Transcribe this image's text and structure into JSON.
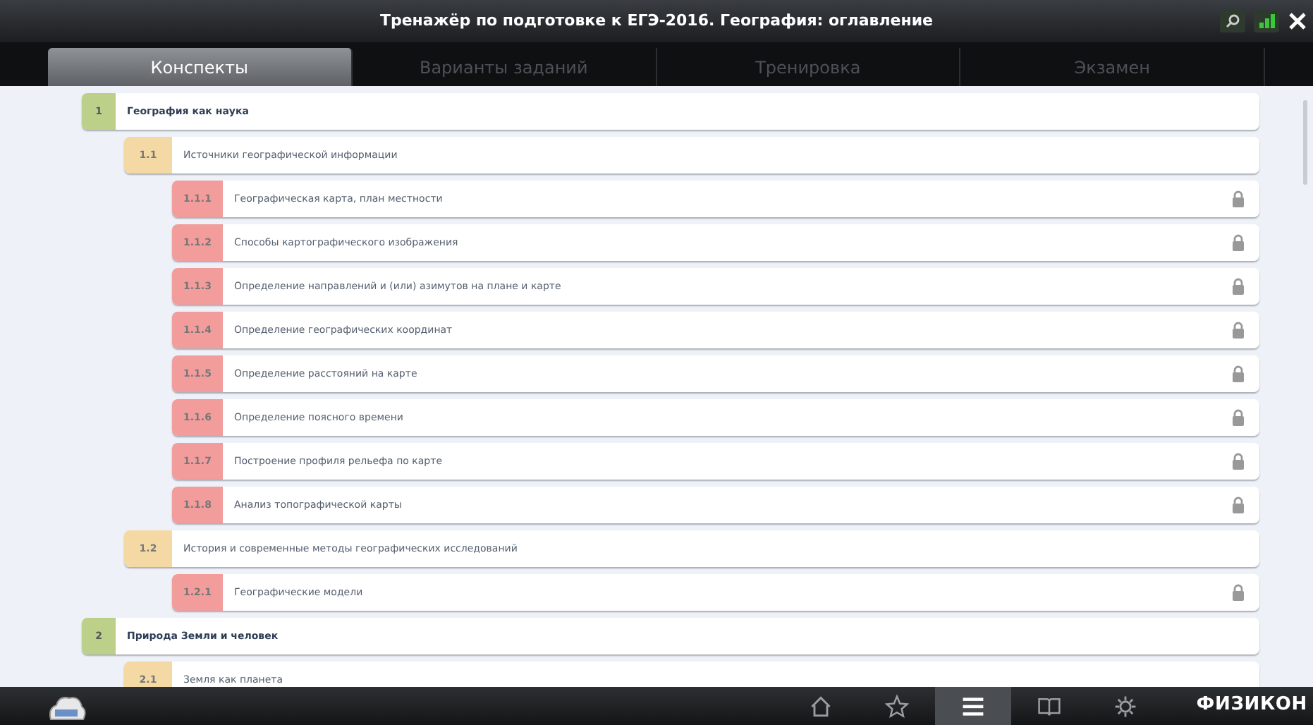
{
  "window": {
    "title": "Тренажёр по подготовке к ЕГЭ-2016. География: оглавление"
  },
  "tabs": [
    {
      "label": "Конспекты",
      "selected": true
    },
    {
      "label": "Варианты заданий",
      "selected": false
    },
    {
      "label": "Тренировка",
      "selected": false
    },
    {
      "label": "Экзамен",
      "selected": false
    }
  ],
  "contents": [
    {
      "number": "1",
      "title": "География как наука",
      "locked": false,
      "children": [
        {
          "number": "1.1",
          "title": "Источники географической информации",
          "locked": false,
          "children": [
            {
              "number": "1.1.1",
              "title": "Географическая карта, план местности",
              "locked": true
            },
            {
              "number": "1.1.2",
              "title": "Способы картографического изображения",
              "locked": true
            },
            {
              "number": "1.1.3",
              "title": "Определение направлений и (или) азимутов на плане и карте",
              "locked": true
            },
            {
              "number": "1.1.4",
              "title": "Определение географических координат",
              "locked": true
            },
            {
              "number": "1.1.5",
              "title": "Определение расстояний на карте",
              "locked": true
            },
            {
              "number": "1.1.6",
              "title": "Определение поясного времени",
              "locked": true
            },
            {
              "number": "1.1.7",
              "title": "Построение профиля рельефа по карте",
              "locked": true
            },
            {
              "number": "1.1.8",
              "title": "Анализ топографической карты",
              "locked": true
            }
          ]
        },
        {
          "number": "1.2",
          "title": "История и современные методы географических исследований",
          "locked": false,
          "children": [
            {
              "number": "1.2.1",
              "title": "Географические модели",
              "locked": true
            }
          ]
        }
      ]
    },
    {
      "number": "2",
      "title": "Природа Земли и человек",
      "locked": false,
      "children": [
        {
          "number": "2.1",
          "title": "Земля как планета",
          "locked": false
        }
      ]
    }
  ],
  "bottom_bar": {
    "nav": [
      {
        "kind": "home",
        "selected": false
      },
      {
        "kind": "star",
        "selected": false
      },
      {
        "kind": "menu",
        "selected": true
      },
      {
        "kind": "book",
        "selected": false
      },
      {
        "kind": "gear",
        "selected": false
      }
    ],
    "brand": "ФИЗИКОН"
  }
}
